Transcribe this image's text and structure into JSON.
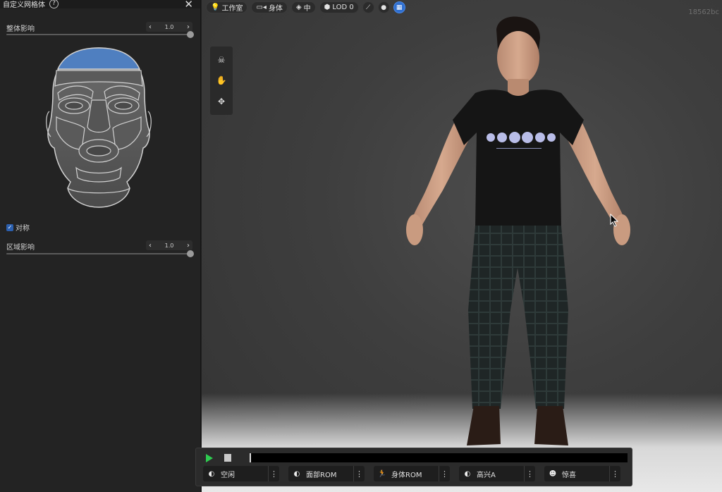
{
  "panel": {
    "title": "自定义网格体",
    "help": "?",
    "close": "✕",
    "overall": {
      "label": "整体影响",
      "value": "1.0",
      "level": 1.0
    },
    "symmetric": {
      "label": "对称",
      "checked": true
    },
    "region": {
      "label": "区域影响",
      "value": "1.0",
      "level": 1.0
    }
  },
  "viewport": {
    "watermark": "18562bc",
    "topbar": {
      "studio": "工作室",
      "body": "身体",
      "quality": "中",
      "lod": "LOD 0"
    },
    "shirt_print_color": "#b9bde8",
    "accent": "#2f6fd0"
  },
  "player": {
    "animations": [
      {
        "label": "空闲",
        "icon": "idle-icon"
      },
      {
        "label": "面部ROM",
        "icon": "face-rom-icon"
      },
      {
        "label": "身体ROM",
        "icon": "running-figure-icon"
      },
      {
        "label": "高兴A",
        "icon": "happy-icon"
      },
      {
        "label": "惊喜",
        "icon": "surprise-icon"
      }
    ],
    "menu_glyph": "⋮"
  }
}
